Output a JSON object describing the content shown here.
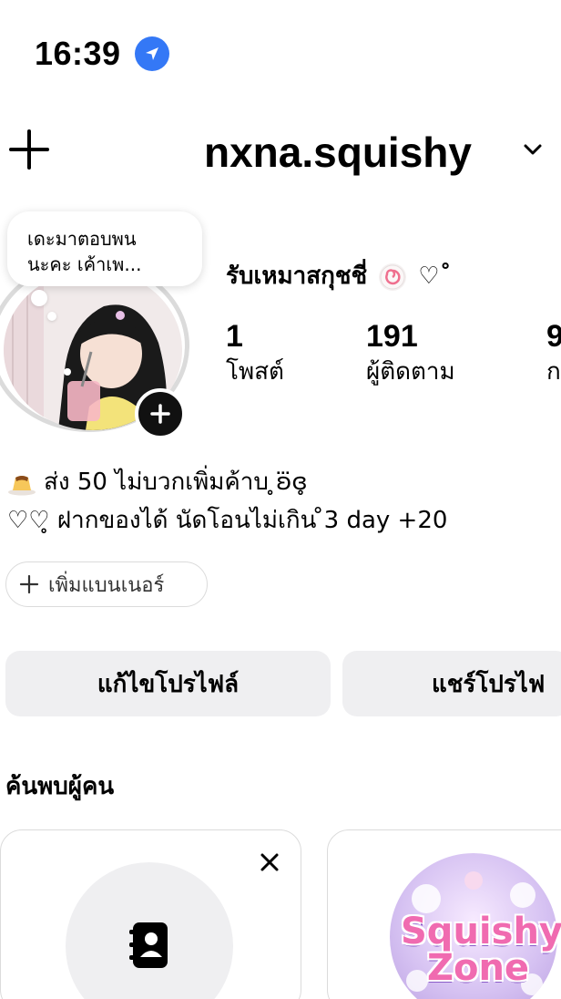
{
  "status_bar": {
    "time": "16:39",
    "location_icon": "location-arrow-icon"
  },
  "header": {
    "username": "nxna.squishy",
    "create_icon": "plus-icon",
    "account_switch_icon": "chevron-down-icon"
  },
  "profile": {
    "note": "เดะมาตอบพน นะคะ เค้าเพ...",
    "add_story_icon": "plus-icon",
    "display_name": "รับเหมาสกุชชี่",
    "display_name_suffix": "♡˚",
    "stats": [
      {
        "value": "1",
        "label": "โพสต์"
      },
      {
        "value": "191",
        "label": "ผู้ติดตาม"
      },
      {
        "value": "9",
        "label": "ก"
      }
    ],
    "bio_line1": "ส่ง 50 ไม่บวกเพิ่มค้าบ ̥ʚ⃛ɞ̥",
    "bio_line2": "♡♡̥ ฝากของได้ นัดโอนไม่เกิน ̊3 day +20",
    "add_banner_label": "เพิ่มแบนเนอร์"
  },
  "actions": {
    "edit_profile": "แก้ไขโปรไฟล์",
    "share_profile": "แชร์โปรไฟ"
  },
  "discover": {
    "title": "ค้นพบผู้คน",
    "close_icon": "close-icon",
    "contacts_icon": "contacts-book-icon",
    "suggested_account_logo_text": [
      "Squishy",
      "Zone"
    ]
  },
  "colors": {
    "accent_blue": "#3478f6",
    "button_gray": "#efeff1",
    "border_gray": "#dbdbdb"
  }
}
